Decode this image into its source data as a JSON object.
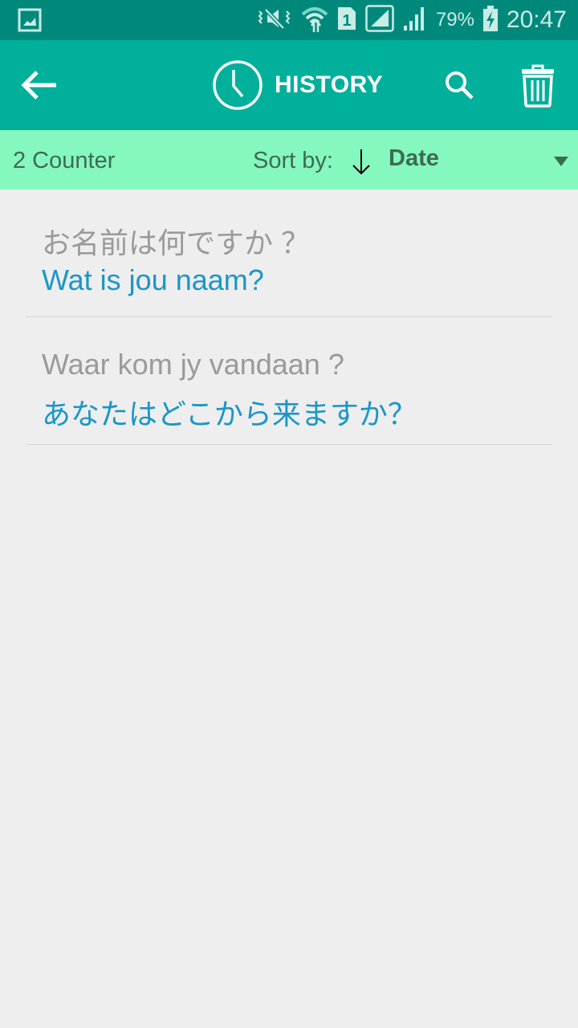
{
  "status_bar": {
    "battery_percent": "79%",
    "time": "20:47",
    "sim_label": "1",
    "icons": [
      "gallery-notification-icon",
      "vibrate-mute-icon",
      "wifi-icon",
      "sim1-icon",
      "signal-icon",
      "signal-icon-2",
      "battery-charging-icon"
    ]
  },
  "app_bar": {
    "title": "HISTORY",
    "icons": [
      "back-arrow-icon",
      "clock-icon",
      "search-icon",
      "trash-icon"
    ]
  },
  "sort_bar": {
    "counter": "2 Counter",
    "sort_label": "Sort by:",
    "sort_direction_icon": "arrow-down-icon",
    "sort_value": "Date"
  },
  "colors": {
    "status_bar": "#00897b",
    "app_bar": "#00b09b",
    "sort_bar": "#85f8bf",
    "source_text": "#9a9a9a",
    "translation_text": "#1a96c8"
  },
  "history": [
    {
      "source": "お名前は何ですか ？",
      "translation": "Wat is jou naam?"
    },
    {
      "source": "Waar kom jy vandaan ?",
      "translation": "あなたはどこから来ますか？"
    }
  ]
}
